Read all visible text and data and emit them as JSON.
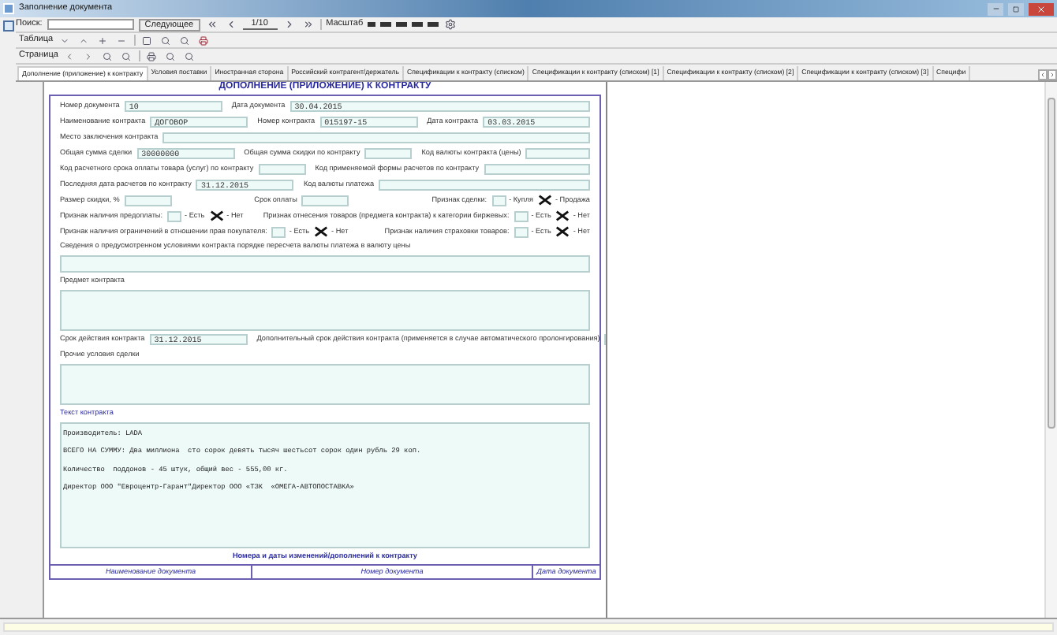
{
  "window": {
    "title": "Заполнение документа"
  },
  "search": {
    "label": "Поиск:",
    "next_button": "Следующее",
    "page": "1/10",
    "zoom_label": "Масштаб"
  },
  "toolbars": [
    {
      "label": "Таблица"
    },
    {
      "label": "Страница"
    }
  ],
  "tabs": [
    {
      "label": "Дополнение (приложение) к контракту",
      "selected": true
    },
    {
      "label": "Условия поставки",
      "selected": false
    },
    {
      "label": "Иностранная сторона",
      "selected": false
    },
    {
      "label": "Российский контрагент/держатель",
      "selected": false
    },
    {
      "label": "Спецификации к контракту (списком)",
      "selected": false
    },
    {
      "label": "Спецификации к контракту (списком) [1]",
      "selected": false
    },
    {
      "label": "Спецификации к контракту (списком) [2]",
      "selected": false
    },
    {
      "label": "Спецификации к контракту (списком) [3]",
      "selected": false
    },
    {
      "label": "Специфи",
      "selected": false
    }
  ],
  "document": {
    "heading": "ДОПОЛНЕНИЕ (ПРИЛОЖЕНИЕ) К КОНТРАКТУ",
    "rows": [
      {
        "kind": "line",
        "items": [
          {
            "kind": "field",
            "label": "Номер документа",
            "value": "10"
          },
          {
            "kind": "field",
            "label": "Дата документа",
            "value": "30.04.2015"
          }
        ]
      },
      {
        "kind": "line",
        "items": [
          {
            "kind": "field",
            "label": "Наименование контракта",
            "value": "ДОГОВОР"
          },
          {
            "kind": "field",
            "label": "Номер контракта",
            "value": "015197-15"
          },
          {
            "kind": "field",
            "label": "Дата контракта",
            "value": "03.03.2015"
          }
        ]
      },
      {
        "kind": "line",
        "items": [
          {
            "kind": "field",
            "label": "Место заключения контракта"
          }
        ]
      },
      {
        "kind": "line",
        "items": [
          {
            "kind": "field",
            "label": "Общая сумма сделки",
            "value": "30000000"
          },
          {
            "kind": "field",
            "label": "Общая сумма скидки по контракту"
          },
          {
            "kind": "field",
            "label": "Код валюты контракта (цены)"
          }
        ]
      },
      {
        "kind": "line",
        "items": [
          {
            "kind": "field",
            "label": "Код расчетного срока оплаты товара (услуг) по контракту"
          },
          {
            "kind": "field",
            "label": "Код применяемой формы расчетов по контракту"
          }
        ]
      },
      {
        "kind": "line",
        "items": [
          {
            "kind": "field",
            "label": "Последняя дата расчетов по контракту",
            "value": "31.12.2015"
          },
          {
            "kind": "field",
            "label": "Код валюты платежа"
          }
        ]
      },
      {
        "kind": "line",
        "items": [
          {
            "kind": "field",
            "label": "Размер скидки, %"
          },
          {
            "kind": "field",
            "label": "Срок оплаты"
          },
          {
            "kind": "choice",
            "label": "Признак сделки:",
            "options": [
              {
                "label": "- Купля",
                "checked": false
              },
              {
                "label": "- Продажа",
                "checked": true
              }
            ]
          }
        ]
      },
      {
        "kind": "line",
        "items": [
          {
            "kind": "choice",
            "label": "Признак наличия предоплаты:",
            "options": [
              {
                "label": "- Есть",
                "checked": false
              },
              {
                "label": "- Нет",
                "checked": true
              }
            ]
          },
          {
            "kind": "choice",
            "label": "Признак отнесения товаров (предмета контракта) к категории биржевых:",
            "options": [
              {
                "label": "- Есть",
                "checked": false
              },
              {
                "label": "- Нет",
                "checked": true
              }
            ]
          }
        ]
      },
      {
        "kind": "line",
        "items": [
          {
            "kind": "choice",
            "label": "Признак наличия ограничений в отношении прав покупателя:",
            "options": [
              {
                "label": "- Есть",
                "checked": false
              },
              {
                "label": "- Нет",
                "checked": true
              }
            ]
          },
          {
            "kind": "choice",
            "label": "Признак наличия страховки товаров:",
            "options": [
              {
                "label": "- Есть",
                "checked": false
              },
              {
                "label": "- Нет",
                "checked": true
              }
            ]
          }
        ]
      },
      {
        "kind": "area",
        "label": "Сведения о предусмотренном условиями контракта порядке пересчета валюты платежа в валюту цены"
      },
      {
        "kind": "area",
        "label": "Предмет контракта"
      },
      {
        "kind": "line",
        "items": [
          {
            "kind": "field",
            "label": "Срок действия контракта",
            "value": "31.12.2015"
          },
          {
            "kind": "field",
            "label": "Дополнительный срок действия контракта (применяется в случае автоматического пролонгирования)"
          }
        ]
      },
      {
        "kind": "area",
        "label": "Прочие условия сделки"
      },
      {
        "kind": "area",
        "label": "Текст контракта",
        "lines": [
          "Производитель: LADA",
          "ВСЕГО НА СУММУ: Два миллиона  сто сорок девять тысяч шестьсот сорок один рубль 29 коп.",
          "Количество  поддонов - 45 штук, общий вес - 555,00 кг.",
          "Директор ООО \"Евроцентр-Гарант\"Директор ООО «ТЗК  «ОМЕГА-АВТОПОСТАВКА»"
        ]
      }
    ],
    "changes_heading": "Номера и даты изменений/дополнений к контракту",
    "changes_table": {
      "columns": [
        "Наименование документа",
        "Номер документа",
        "Дата документа"
      ]
    }
  }
}
